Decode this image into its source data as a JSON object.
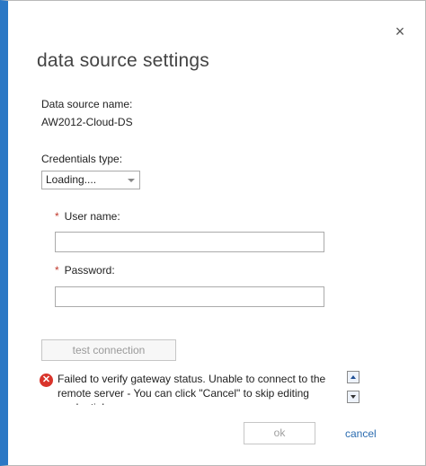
{
  "dialog": {
    "title": "data source settings",
    "close_label": "×"
  },
  "fields": {
    "data_source_name_label": "Data source name:",
    "data_source_name_value": "AW2012-Cloud-DS",
    "credentials_type_label": "Credentials type:",
    "credentials_type_value": "Loading....",
    "required_marker": "*",
    "user_name_label": "User name:",
    "user_name_value": "",
    "password_label": "Password:",
    "password_value": ""
  },
  "actions": {
    "test_connection_label": "test connection",
    "ok_label": "ok",
    "cancel_label": "cancel"
  },
  "error": {
    "icon_glyph": "✕",
    "message": "Failed to verify gateway status. Unable to connect to the remote server - You can click \"Cancel\" to skip editing credentials."
  },
  "colors": {
    "accent": "#2b78c5",
    "error": "#d9342b",
    "link": "#2b6cb0"
  }
}
